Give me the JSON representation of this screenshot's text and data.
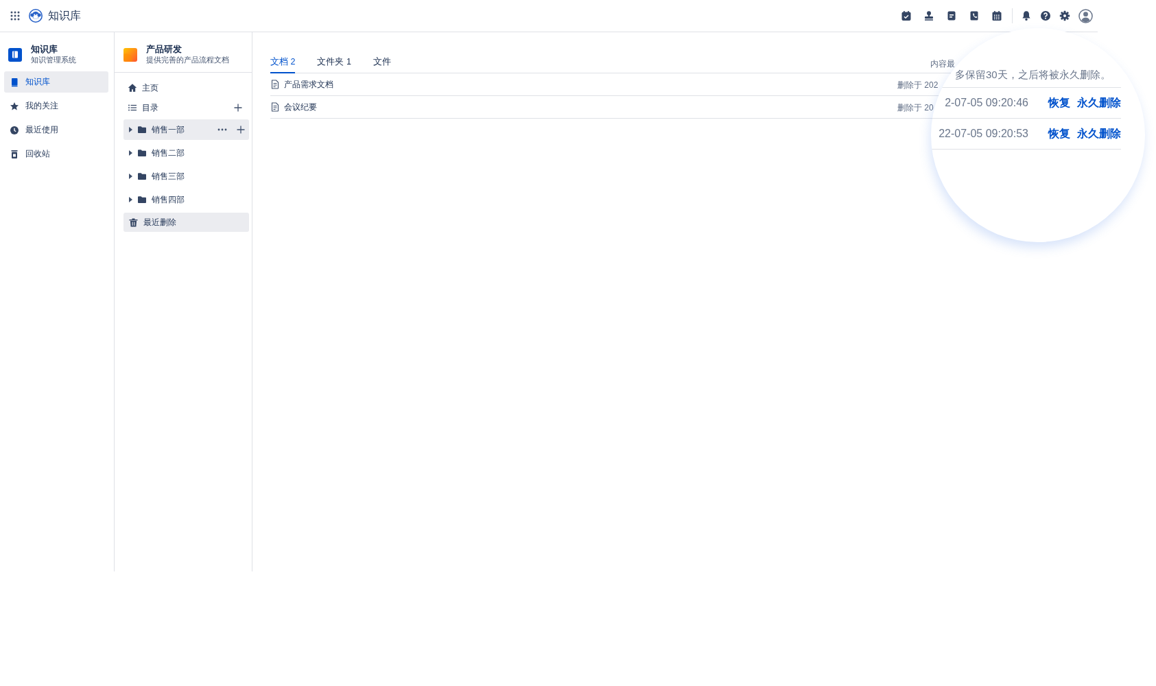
{
  "top_bar": {
    "app_name": "知识库"
  },
  "space_sidebar": {
    "title": "知识库",
    "subtitle": "知识管理系统",
    "items": [
      {
        "label": "知识库",
        "selected": true
      },
      {
        "label": "我的关注",
        "selected": false
      },
      {
        "label": "最近使用",
        "selected": false
      },
      {
        "label": "回收站",
        "selected": false
      }
    ]
  },
  "space_panel": {
    "title": "产品研发",
    "subtitle": "提供完善的产品流程文档",
    "nav": [
      {
        "label": "主页",
        "selected": false,
        "add_button": false
      },
      {
        "label": "目录",
        "selected": false,
        "add_button": true
      }
    ],
    "folders": [
      {
        "label": "销售一部",
        "expanded": false,
        "hovered": true
      },
      {
        "label": "销售二部",
        "expanded": false,
        "hovered": false
      },
      {
        "label": "销售三部",
        "expanded": false,
        "hovered": false
      },
      {
        "label": "销售四部",
        "expanded": false,
        "hovered": false
      }
    ],
    "recently_deleted": {
      "label": "最近删除",
      "selected": true
    }
  },
  "content": {
    "tabs": [
      {
        "label": "文档 2",
        "selected": true
      },
      {
        "label": "文件夹 1",
        "selected": false
      },
      {
        "label": "文件",
        "selected": false
      }
    ],
    "note": "内容最",
    "rows": [
      {
        "name": "产品需求文档",
        "deleted": "删除于 202"
      },
      {
        "name": "会议纪要",
        "deleted": "删除于 20"
      }
    ]
  },
  "magnifier": {
    "note": "多保留30天，之后将被永久删除。",
    "rows": [
      {
        "time": "2-07-05 09:20:46",
        "actions": [
          "恢复",
          "永久删除"
        ]
      },
      {
        "time": "22-07-05 09:20:53",
        "actions": [
          "恢复",
          "永久删除"
        ]
      }
    ]
  }
}
